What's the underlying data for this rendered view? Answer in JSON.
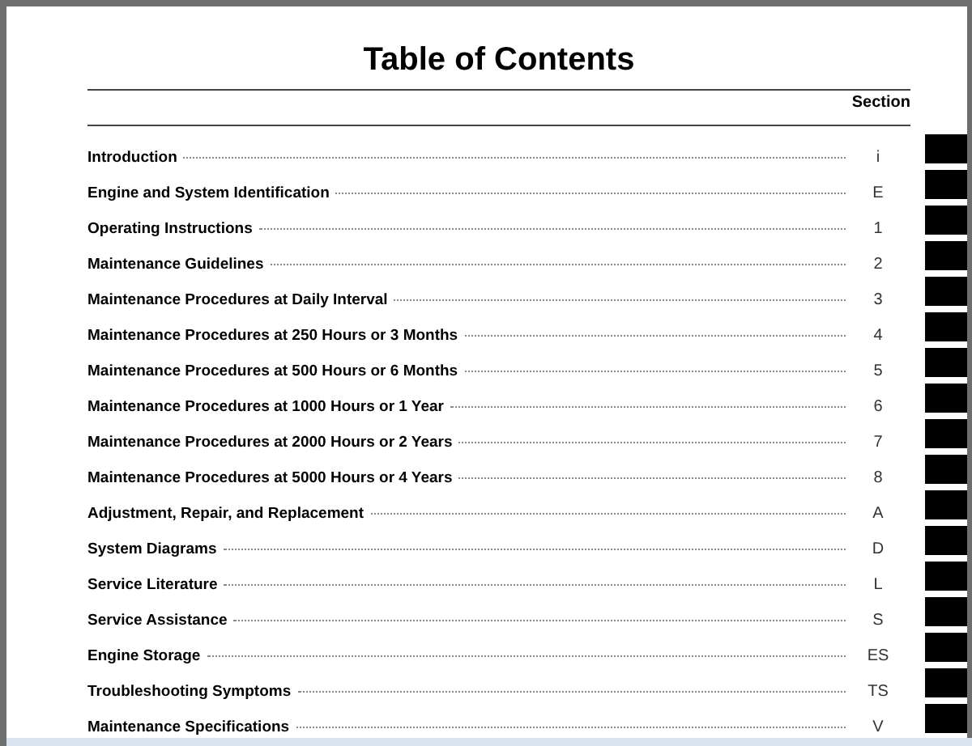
{
  "title": "Table of Contents",
  "column_heading": "Section",
  "entries": [
    {
      "label": "Introduction",
      "section": "i"
    },
    {
      "label": "Engine and System Identification",
      "section": "E"
    },
    {
      "label": "Operating Instructions",
      "section": "1"
    },
    {
      "label": "Maintenance Guidelines",
      "section": "2"
    },
    {
      "label": "Maintenance Procedures at Daily Interval",
      "section": "3"
    },
    {
      "label": "Maintenance Procedures at 250 Hours or 3 Months",
      "section": "4"
    },
    {
      "label": "Maintenance Procedures at 500 Hours or 6 Months",
      "section": "5"
    },
    {
      "label": "Maintenance Procedures at 1000 Hours or 1 Year",
      "section": "6"
    },
    {
      "label": "Maintenance Procedures at 2000 Hours or 2 Years",
      "section": "7"
    },
    {
      "label": "Maintenance Procedures at 5000 Hours or 4 Years",
      "section": "8"
    },
    {
      "label": "Adjustment, Repair, and Replacement",
      "section": "A"
    },
    {
      "label": "System Diagrams",
      "section": "D"
    },
    {
      "label": "Service Literature",
      "section": "L"
    },
    {
      "label": "Service Assistance",
      "section": "S"
    },
    {
      "label": "Engine Storage",
      "section": "ES"
    },
    {
      "label": "Troubleshooting Symptoms",
      "section": "TS"
    },
    {
      "label": "Maintenance Specifications",
      "section": "V"
    }
  ]
}
